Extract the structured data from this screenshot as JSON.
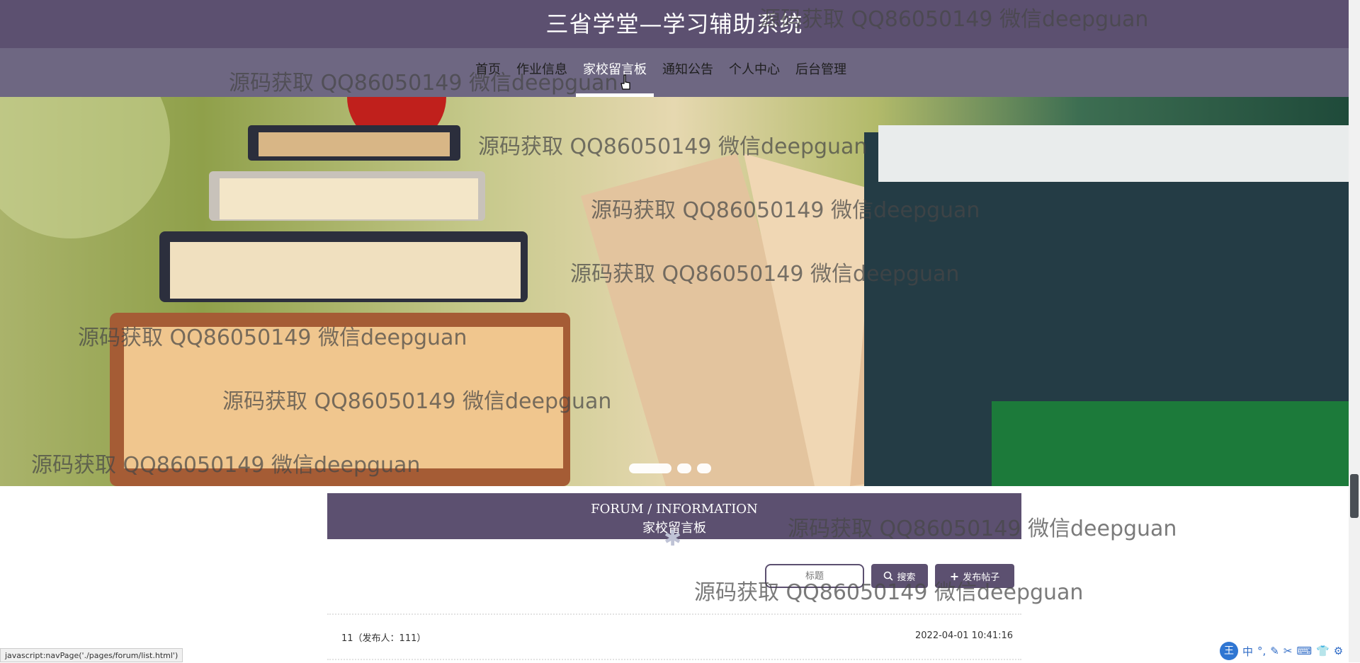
{
  "header": {
    "title": "三省学堂—学习辅助系统"
  },
  "nav": {
    "items": [
      {
        "label": "首页",
        "active": false
      },
      {
        "label": "作业信息",
        "active": false
      },
      {
        "label": "家校留言板",
        "active": true
      },
      {
        "label": "通知公告",
        "active": false
      },
      {
        "label": "个人中心",
        "active": false
      },
      {
        "label": "后台管理",
        "active": false
      }
    ]
  },
  "watermark": {
    "text": "源码获取 QQ86050149 微信deepguan"
  },
  "section": {
    "title_en": "FORUM / INFORMATION",
    "title_cn": "家校留言板"
  },
  "search": {
    "placeholder": "标题",
    "button_label": "搜索"
  },
  "post_button": {
    "label": "发布帖子"
  },
  "posts": [
    {
      "title": "11（发布人：111）",
      "date": "2022-04-01 10:41:16"
    }
  ],
  "status_bar": {
    "text": "javascript:navPage('./pages/forum/list.html')"
  },
  "ime": {
    "logo": "王",
    "items": [
      "中",
      "°,",
      "✎",
      "✂",
      "⌨",
      "👕",
      "⚙"
    ]
  },
  "colors": {
    "primary": "#5c5070",
    "nav_bg": "#6e6782"
  }
}
